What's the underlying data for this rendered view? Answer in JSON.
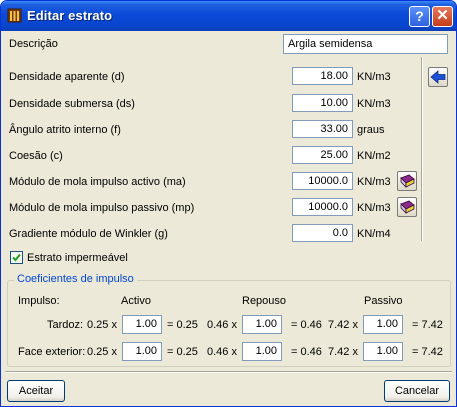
{
  "window": {
    "title": "Editar estrato",
    "help_button": "?",
    "close_button": "✕"
  },
  "form": {
    "descricao": {
      "label": "Descrição",
      "value": "Argila semidensa"
    },
    "fields": [
      {
        "label": "Densidade aparente (d)",
        "value": "18.00",
        "unit": "KN/m3"
      },
      {
        "label": "Densidade submersa (ds)",
        "value": "10.00",
        "unit": "KN/m3"
      },
      {
        "label": "Ângulo atrito interno (f)",
        "value": "33.00",
        "unit": "graus"
      },
      {
        "label": "Coesão (c)",
        "value": "25.00",
        "unit": "KN/m2"
      },
      {
        "label": "Módulo de mola impulso activo (ma)",
        "value": "10000.0",
        "unit": "KN/m3"
      },
      {
        "label": "Módulo de mola impulso passivo (mp)",
        "value": "10000.0",
        "unit": "KN/m3"
      },
      {
        "label": "Gradiente módulo de Winkler (g)",
        "value": "0.0",
        "unit": "KN/m4"
      }
    ],
    "impermeavel": {
      "label": "Estrato impermeável",
      "checked": true
    }
  },
  "coef": {
    "title": "Coeficientes de impulso",
    "header": {
      "impulso": "Impulso:",
      "activo": "Activo",
      "repouso": "Repouso",
      "passivo": "Passivo"
    },
    "rows": [
      {
        "label": "Tardoz:",
        "activo": {
          "mult": "0.25 x",
          "value": "1.00",
          "result": "= 0.25"
        },
        "repouso": {
          "mult": "0.46 x",
          "value": "1.00",
          "result": "= 0.46"
        },
        "passivo": {
          "mult": "7.42 x",
          "value": "1.00",
          "result": "= 7.42"
        }
      },
      {
        "label": "Face exterior:",
        "activo": {
          "mult": "0.25 x",
          "value": "1.00",
          "result": "= 0.25"
        },
        "repouso": {
          "mult": "0.46 x",
          "value": "1.00",
          "result": "= 0.46"
        },
        "passivo": {
          "mult": "7.42 x",
          "value": "1.00",
          "result": "= 7.42"
        }
      }
    ]
  },
  "buttons": {
    "ok": "Aceitar",
    "cancel": "Cancelar"
  },
  "icons": {
    "arrow": "arrow-left-icon",
    "book": "book-icon"
  },
  "colors": {
    "titlebar": "#0a4ad8",
    "accent_arrow": "#1c4fd6",
    "group_title": "#0046d5"
  }
}
